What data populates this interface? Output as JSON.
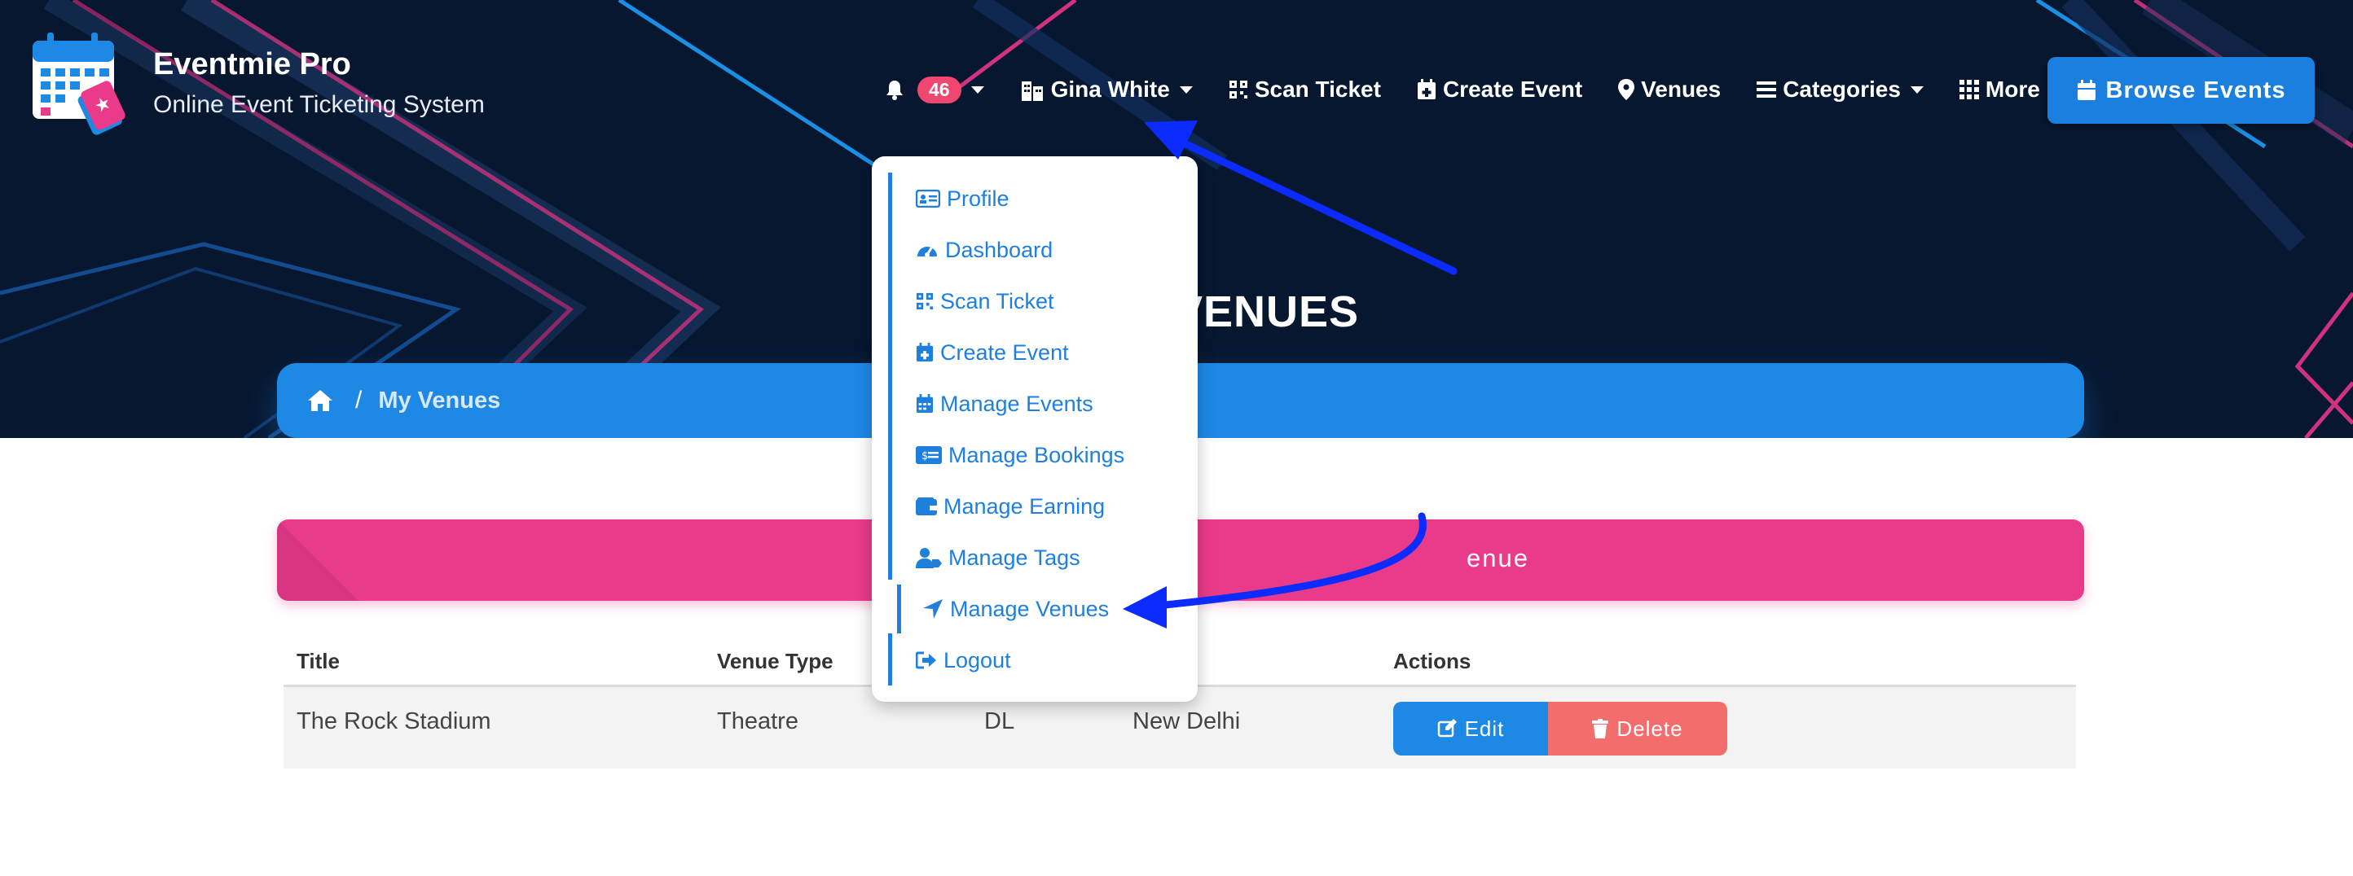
{
  "brand": {
    "title": "Eventmie Pro",
    "subtitle": "Online Event Ticketing System"
  },
  "nav": {
    "notification_count": "46",
    "user_name": "Gina White",
    "scan_ticket": "Scan Ticket",
    "create_event": "Create Event",
    "venues": "Venues",
    "categories": "Categories",
    "more": "More",
    "browse_events": "Browse Events"
  },
  "page": {
    "title_visible": "VENUES"
  },
  "breadcrumb": {
    "separator": "/",
    "current": "My Venues"
  },
  "action_bar": {
    "label_visible": "enue"
  },
  "table": {
    "headers": [
      "Title",
      "Venue Type",
      "",
      "",
      "Actions"
    ],
    "rows": [
      {
        "title": "The Rock Stadium",
        "venue_type": "Theatre",
        "state": "DL",
        "city": "New Delhi"
      }
    ],
    "edit_label": "Edit",
    "delete_label": "Delete"
  },
  "user_menu": {
    "items": [
      {
        "label": "Profile",
        "icon": "id-card-icon"
      },
      {
        "label": "Dashboard",
        "icon": "gauge-icon"
      },
      {
        "label": "Scan Ticket",
        "icon": "qrcode-icon"
      },
      {
        "label": "Create Event",
        "icon": "calendar-plus-icon"
      },
      {
        "label": "Manage Events",
        "icon": "calendar-icon"
      },
      {
        "label": "Manage Bookings",
        "icon": "money-check-icon"
      },
      {
        "label": "Manage Earning",
        "icon": "wallet-icon"
      },
      {
        "label": "Manage Tags",
        "icon": "user-tag-icon"
      },
      {
        "label": "Manage Venues",
        "icon": "location-arrow-icon"
      },
      {
        "label": "Logout",
        "icon": "sign-out-icon"
      }
    ],
    "active_index": 8
  },
  "colors": {
    "hero_bg": "#071730",
    "primary_blue": "#1e88e5",
    "pink": "#ea3b8a",
    "delete_red": "#f46d6d",
    "annotation_arrow": "#0b2bff"
  }
}
